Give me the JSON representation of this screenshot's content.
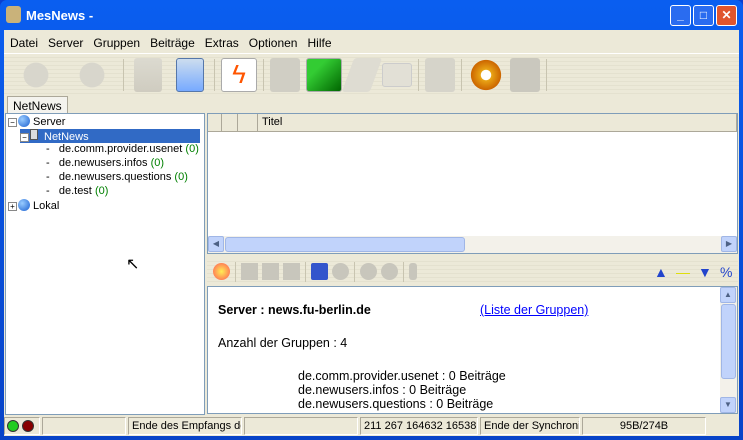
{
  "window": {
    "title": "MesNews -"
  },
  "menu": [
    "Datei",
    "Server",
    "Gruppen",
    "Beiträge",
    "Extras",
    "Optionen",
    "Hilfe"
  ],
  "toolbar": [
    "connect-icon",
    "connect-all-icon",
    "refresh-icon",
    "sync-icon",
    "lightning-icon",
    "save-icon",
    "folder-icon",
    "newspaper-icon",
    "card-icon",
    "printer-icon",
    "gear-icon",
    "fax-icon"
  ],
  "tab": "NetNews",
  "tree": {
    "server": "Server",
    "netnews": "NetNews",
    "groups": [
      {
        "name": "de.comm.provider.usenet",
        "count": "(0)"
      },
      {
        "name": "de.newusers.infos",
        "count": "(0)"
      },
      {
        "name": "de.newusers.questions",
        "count": "(0)"
      },
      {
        "name": "de.test",
        "count": "(0)"
      }
    ],
    "local": "Lokal"
  },
  "list": {
    "columns": [
      "",
      "",
      "",
      "Titel"
    ]
  },
  "preview": {
    "server_label": "Server : news.fu-berlin.de",
    "link": "(Liste der Gruppen)",
    "count_label": "Anzahl der Gruppen : 4",
    "lines": [
      "de.comm.provider.usenet : 0 Beiträge",
      "de.newusers.infos : 0 Beiträge",
      "de.newusers.questions : 0 Beiträge"
    ]
  },
  "status": {
    "s1": "",
    "s2": "Ende des Empfangs de",
    "s3": "",
    "s4": "211 267 164632 16538",
    "s5": "Ende der Synchronistation",
    "s6": "95B/274B"
  },
  "colors": {
    "selection": "#316ac5",
    "count": "#008000",
    "link": "#0000ff"
  }
}
